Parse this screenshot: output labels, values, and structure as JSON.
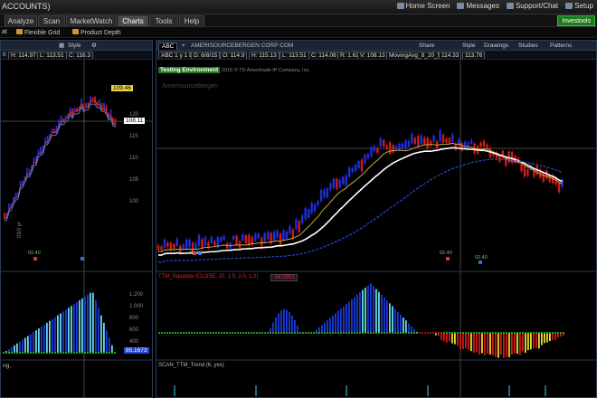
{
  "window": {
    "title": "ACCOUNTS)"
  },
  "top_links": [
    "Home Screen",
    "Messages",
    "Support/Chat",
    "Setup"
  ],
  "menu": {
    "tabs": [
      "Analyze",
      "Scan",
      "MarketWatch",
      "Charts",
      "Tools",
      "Help"
    ],
    "active": "Charts",
    "badge": "Investools"
  },
  "subbar": {
    "left": "at",
    "flexible_grid": "Flexible Grid",
    "product_depth": "Product Depth"
  },
  "left_chart": {
    "quote": [
      "H: 114.97",
      "L: 113.51",
      "C: 116.3"
    ],
    "quote_prefix": "0",
    "style_label": "Style",
    "price_tag": "109.46",
    "price_tag2": "108.11",
    "y_labels": [
      "120",
      "115",
      "110",
      "105",
      "100"
    ],
    "indicator_value": "85.1673",
    "indicator_labels": [
      "1.200",
      "1.000",
      "800",
      "600",
      "400",
      "200"
    ],
    "bottom_label": "ng,",
    "period_label": "010 yr",
    "earn_label": "02.40"
  },
  "right_chart": {
    "symbol": "ABC",
    "company": "AMERISOURCEBERGEN CORP COM",
    "toolbar": [
      "Share",
      "Style",
      "Drawings",
      "Studies",
      "Patterns"
    ],
    "quote": [
      "ABC 1 y 1 D",
      "D: 6/8/15",
      "O: 114.9",
      "H: 115.13",
      "L: 113.51",
      "C: 114.06",
      "R: 1.62",
      "V: 108.13",
      "MovingAvg_8_20_50",
      "114.33",
      "113.76"
    ],
    "testing": "Testing Environment",
    "copyright": "2015 © TD Ameritrade IP Company, Inc.",
    "watermark": "AmerisourceBergen",
    "lower_study": "TTM_Squeeze (CLOSE, 20, 1.5, 2.0, 1.0)",
    "lower_value": "-84.0951",
    "trend_study": "SCAN_TTM_Trend (6, yes)",
    "earn_labels": [
      "02.40",
      "02.40",
      "02.40",
      "01.40"
    ]
  },
  "colors": {
    "up_bar": "#1e2fd8",
    "down_bar": "#d01a1a",
    "ma_fast": "#c8a63a",
    "ma_mid": "#ffffff",
    "ma_slow": "#1f4fd0",
    "hist_up": "#1a3adb",
    "hist_up2": "#66d9e8",
    "hist_down": "#d01a1a",
    "hist_down2": "#e7e02a",
    "squeeze_dot": "#2acc2a"
  }
}
